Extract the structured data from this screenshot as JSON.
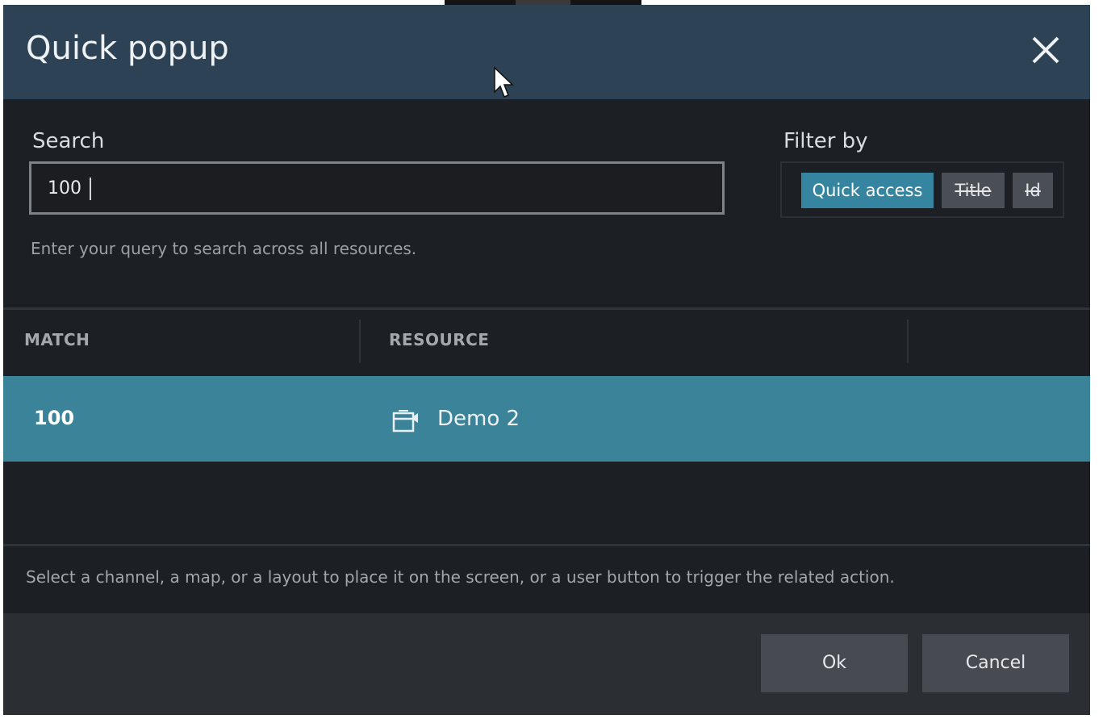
{
  "dialog": {
    "title": "Quick popup",
    "close_icon": "close-icon"
  },
  "search": {
    "label": "Search",
    "value": "100",
    "hint": "Enter your query to search across all resources."
  },
  "filter": {
    "label": "Filter by",
    "options": [
      {
        "label": "Quick access",
        "active": true
      },
      {
        "label": "Title",
        "active": false
      },
      {
        "label": "Id",
        "active": false
      }
    ]
  },
  "table": {
    "columns": [
      "MATCH",
      "RESOURCE"
    ],
    "rows": [
      {
        "match": "100",
        "resource": "Demo 2",
        "icon": "layout-channel-icon"
      }
    ]
  },
  "footer": {
    "note": "Select a channel, a map, or a layout to place it on the screen, or a user button to trigger the related action.",
    "ok_label": "Ok",
    "cancel_label": "Cancel"
  },
  "colors": {
    "titlebar": "#2d4254",
    "accent": "#3685a0",
    "selected_row": "#3b8399",
    "background": "#1c1f24"
  }
}
